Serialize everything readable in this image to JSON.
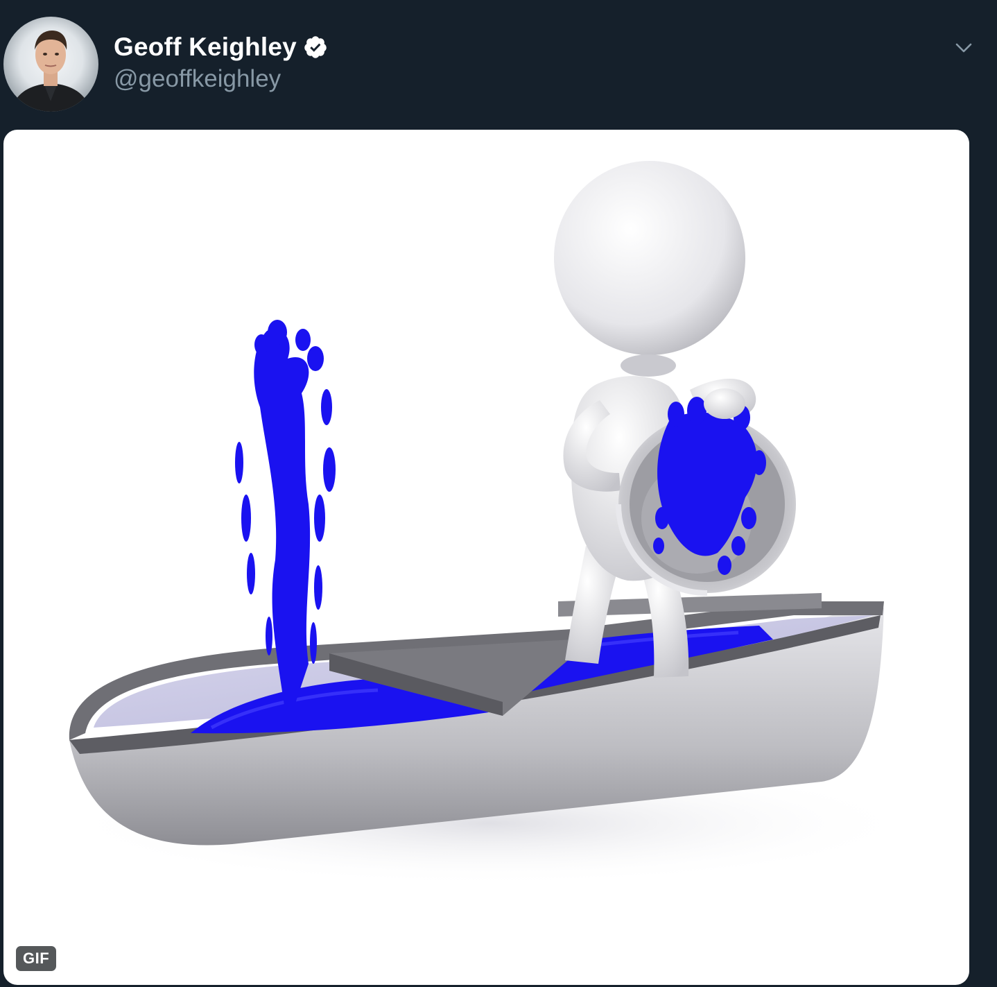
{
  "tweet": {
    "author": {
      "display_name": "Geoff Keighley",
      "handle": "@geoffkeighley",
      "verified": true,
      "avatar_icon": "profile-photo"
    },
    "menu_icon": "chevron-down-icon",
    "media": {
      "type": "gif",
      "badge_label": "GIF",
      "subject_icon": "stick-figure-bailing-water-from-boat"
    },
    "colors": {
      "background": "#15202b",
      "name": "#ffffff",
      "handle": "#8899a6",
      "verified_badge": "#ffffff",
      "water": "#1a12f0"
    }
  }
}
